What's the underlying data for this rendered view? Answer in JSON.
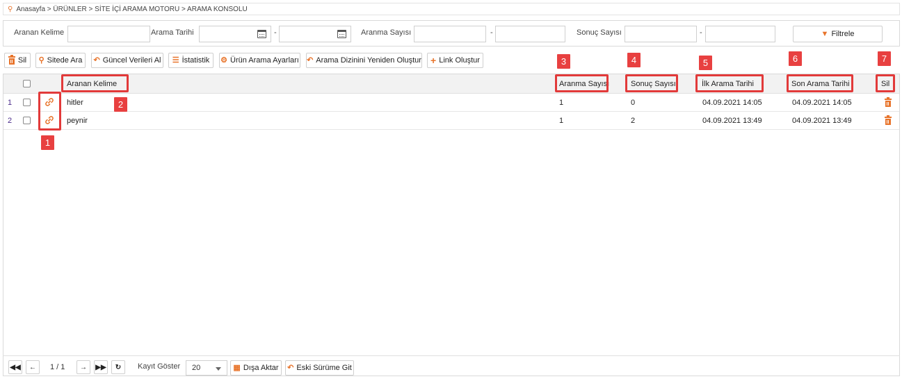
{
  "breadcrumb": "Anasayfa > ÜRÜNLER > SİTE İÇİ ARAMA MOTORU > ARAMA KONSOLU",
  "filters": {
    "keyword_label": "Aranan Kelime",
    "keyword_value": "",
    "date_label": "Arama Tarihi",
    "date_from": "",
    "date_to": "",
    "search_count_label": "Aranma Sayısı",
    "result_count_label": "Sonuç Sayısı",
    "range_separator": "-",
    "filter_button": "Filtrele"
  },
  "toolbar": {
    "delete": "Sil",
    "search_site": "Sitede Ara",
    "refresh": "Güncel Verileri Al",
    "stats": "İstatistik",
    "settings": "Ürün Arama Ayarları",
    "rebuild_index": "Arama Dizinini Yeniden Oluştur",
    "create_link": "Link Oluştur"
  },
  "columns": {
    "keyword": "Aranan Kelime",
    "search_count": "Aranma Sayısı",
    "result_count": "Sonuç Sayısı",
    "first_date": "İlk Arama Tarihi",
    "last_date": "Son Arama Tarihi",
    "delete": "Sil"
  },
  "rows": [
    {
      "num": "1",
      "keyword": "hitler",
      "search_count": "1",
      "result_count": "0",
      "first_date": "04.09.2021 14:05",
      "last_date": "04.09.2021 14:05"
    },
    {
      "num": "2",
      "keyword": "peynir",
      "search_count": "1",
      "result_count": "2",
      "first_date": "04.09.2021 13:49",
      "last_date": "04.09.2021 13:49"
    }
  ],
  "annotations": [
    "1",
    "2",
    "3",
    "4",
    "5",
    "6",
    "7"
  ],
  "pager": {
    "page_info": "1 / 1",
    "page_size_label": "Kayıt Göster",
    "page_size": "20",
    "export": "Dışa Aktar",
    "old_version": "Eski Sürüme Git"
  },
  "colors": {
    "accent": "#e8742b",
    "annotation": "#e23a3a",
    "row_number": "#4a2b8a"
  }
}
